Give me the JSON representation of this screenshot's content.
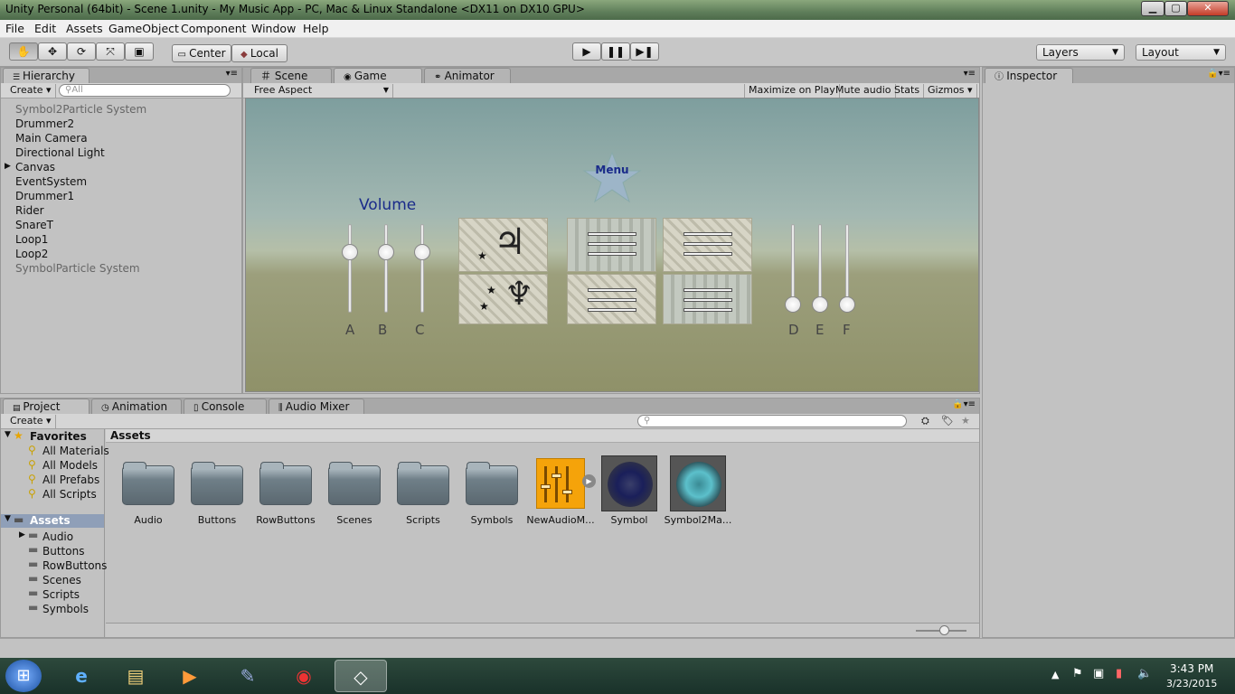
{
  "window": {
    "title": "Unity Personal (64bit) - Scene 1.unity - My Music App - PC, Mac & Linux Standalone <DX11 on DX10 GPU>"
  },
  "menu": [
    "File",
    "Edit",
    "Assets",
    "GameObject",
    "Component",
    "Window",
    "Help"
  ],
  "toolbar": {
    "center": "Center",
    "local": "Local",
    "layers": "Layers",
    "layout": "Layout"
  },
  "hierarchy": {
    "tab": "Hierarchy",
    "create": "Create",
    "search_placeholder": "All",
    "items": [
      "Symbol2Particle System",
      "Drummer2",
      "Main Camera",
      "Directional Light",
      "Canvas",
      "EventSystem",
      "Drummer1",
      "Rider",
      "SnareT",
      "Loop1",
      "Loop2",
      "SymbolParticle System"
    ]
  },
  "scene_tabs": {
    "scene": "Scene",
    "game": "Game",
    "animator": "Animator"
  },
  "game_bar": {
    "aspect": "Free Aspect",
    "maximize": "Maximize on Play",
    "mute": "Mute audio",
    "stats": "Stats",
    "gizmos": "Gizmos"
  },
  "game": {
    "menu_label": "Menu",
    "volume_label": "Volume",
    "left_sliders": [
      {
        "label": "A",
        "level": 0.7
      },
      {
        "label": "B",
        "level": 0.7
      },
      {
        "label": "C",
        "level": 0.7
      }
    ],
    "right_sliders": [
      {
        "label": "D",
        "level": 0.1
      },
      {
        "label": "E",
        "level": 0.1
      },
      {
        "label": "F",
        "level": 0.1
      }
    ],
    "symbol_glyphs": [
      "♃",
      "♆"
    ]
  },
  "inspector": {
    "tab": "Inspector"
  },
  "bottom_tabs": {
    "project": "Project",
    "animation": "Animation",
    "console": "Console",
    "mixer": "Audio Mixer"
  },
  "project": {
    "create": "Create",
    "favorites_label": "Favorites",
    "favorites": [
      "All Materials",
      "All Models",
      "All Prefabs",
      "All Scripts"
    ],
    "assets_label": "Assets",
    "asset_tree": [
      "Audio",
      "Buttons",
      "RowButtons",
      "Scenes",
      "Scripts",
      "Symbols"
    ],
    "breadcrumb": "Assets",
    "assets": [
      "Audio",
      "Buttons",
      "RowButtons",
      "Scenes",
      "Scripts",
      "Symbols",
      "NewAudioM...",
      "Symbol",
      "Symbol2Ma..."
    ]
  },
  "taskbar": {
    "time": "3:43 PM",
    "date": "3/23/2015"
  },
  "colors": {
    "accent": "#f5a30a",
    "volume_text": "#1a2b8a"
  }
}
